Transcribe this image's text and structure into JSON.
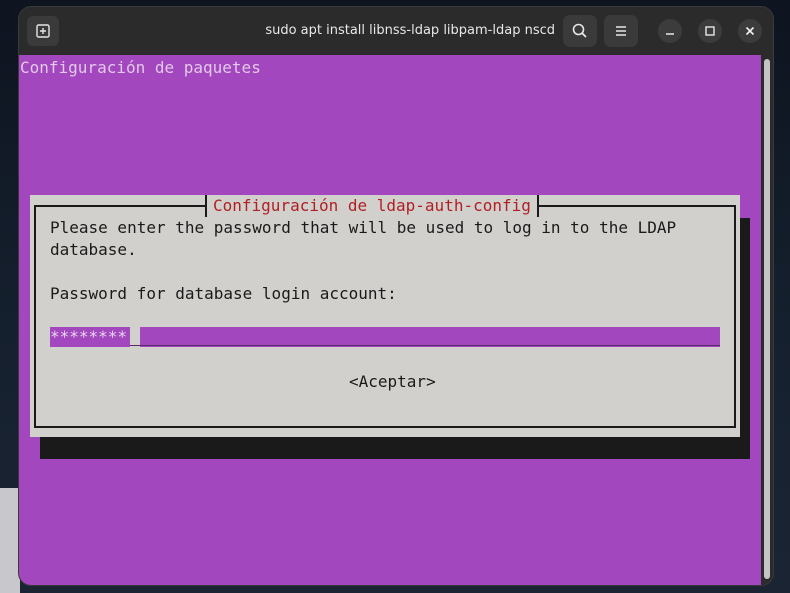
{
  "window": {
    "title": "sudo apt install libnss-ldap libpam-ldap nscd"
  },
  "icons": {
    "new_tab": "new-tab-icon",
    "search": "search-icon",
    "menu": "hamburger-menu-icon",
    "minimize": "minimize-icon",
    "maximize": "maximize-icon",
    "close": "close-icon"
  },
  "terminal": {
    "heading": "Configuración de paquetes",
    "background_color": "#a247bd"
  },
  "dialog": {
    "title": "Configuración de ldap-auth-config",
    "message_line1": "Please enter the password that will be used to log in to the LDAP",
    "message_line2": "database.",
    "prompt": "Password for database login account:",
    "password_value": "********",
    "ok_label": "<Aceptar>",
    "title_color": "#b01f25"
  }
}
